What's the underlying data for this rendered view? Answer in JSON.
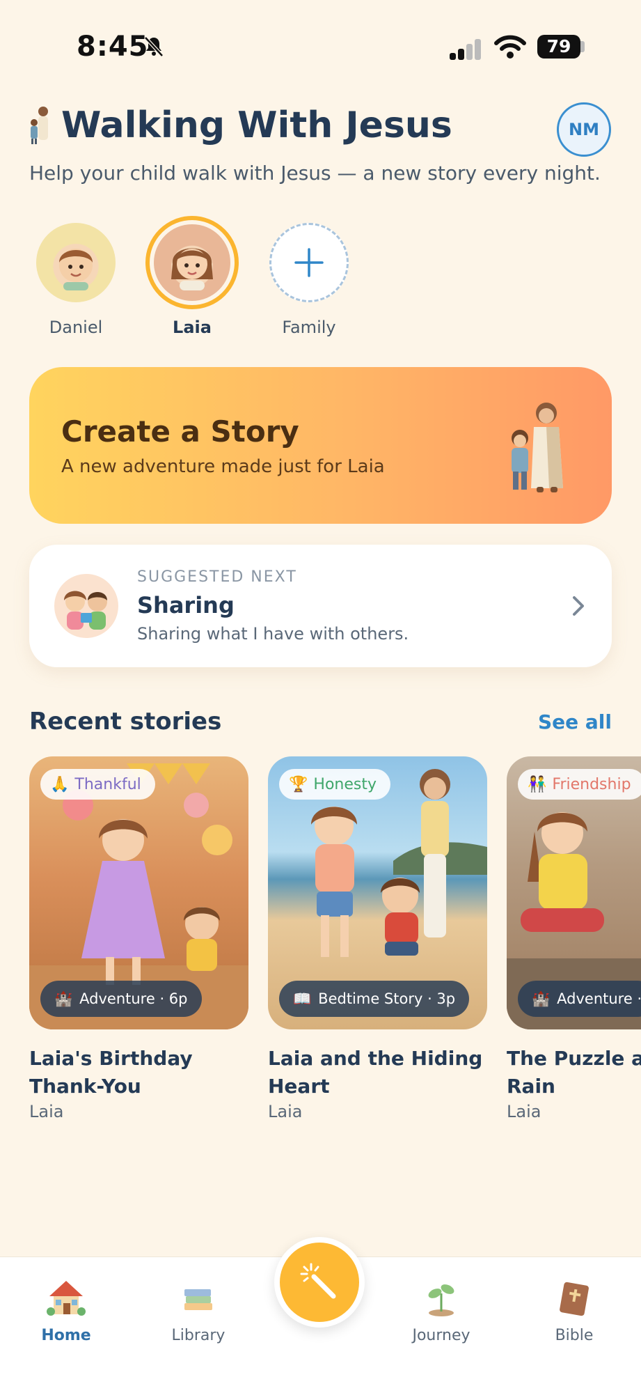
{
  "status_bar": {
    "time": "8:45",
    "battery": "79"
  },
  "header": {
    "title": "Walking With Jesus",
    "subtitle": "Help your child walk with Jesus — a new story every night.",
    "account_initials": "NM"
  },
  "profiles": [
    {
      "name": "Daniel",
      "selected": false
    },
    {
      "name": "Laia",
      "selected": true
    },
    {
      "name": "Family",
      "selected": false
    }
  ],
  "create_card": {
    "title": "Create a Story",
    "subtitle": "A new adventure made just for Laia"
  },
  "suggested": {
    "eyebrow": "SUGGESTED NEXT",
    "title": "Sharing",
    "subtitle": "Sharing what I have with others."
  },
  "recent": {
    "heading": "Recent stories",
    "see_all": "See all",
    "stories": [
      {
        "tag": "Thankful",
        "tag_icon": "praying-hands",
        "tag_color": "#7C6BC4",
        "meta": "Adventure · 6p",
        "meta_icon": "castle",
        "title": "Laia's Birthday\nThank-You",
        "owner": "Laia"
      },
      {
        "tag": "Honesty",
        "tag_icon": "trophy",
        "tag_color": "#3FA66A",
        "meta": "Bedtime Story · 3p",
        "meta_icon": "open-book",
        "title": "Laia and the Hiding\nHeart",
        "owner": "Laia"
      },
      {
        "tag": "Friendship",
        "tag_icon": "friends",
        "tag_color": "#E2776A",
        "meta": "Adventure ·",
        "meta_icon": "castle",
        "title": "The Puzzle ar\nRain",
        "owner": "Laia"
      }
    ]
  },
  "tabbar": {
    "tabs": [
      {
        "label": "Home",
        "icon": "house-icon",
        "active": true
      },
      {
        "label": "Library",
        "icon": "books-icon",
        "active": false
      },
      {
        "label": "Journey",
        "icon": "sprout-icon",
        "active": false
      },
      {
        "label": "Bible",
        "icon": "bible-icon",
        "active": false
      }
    ],
    "fab_icon": "magic-wand-icon"
  }
}
